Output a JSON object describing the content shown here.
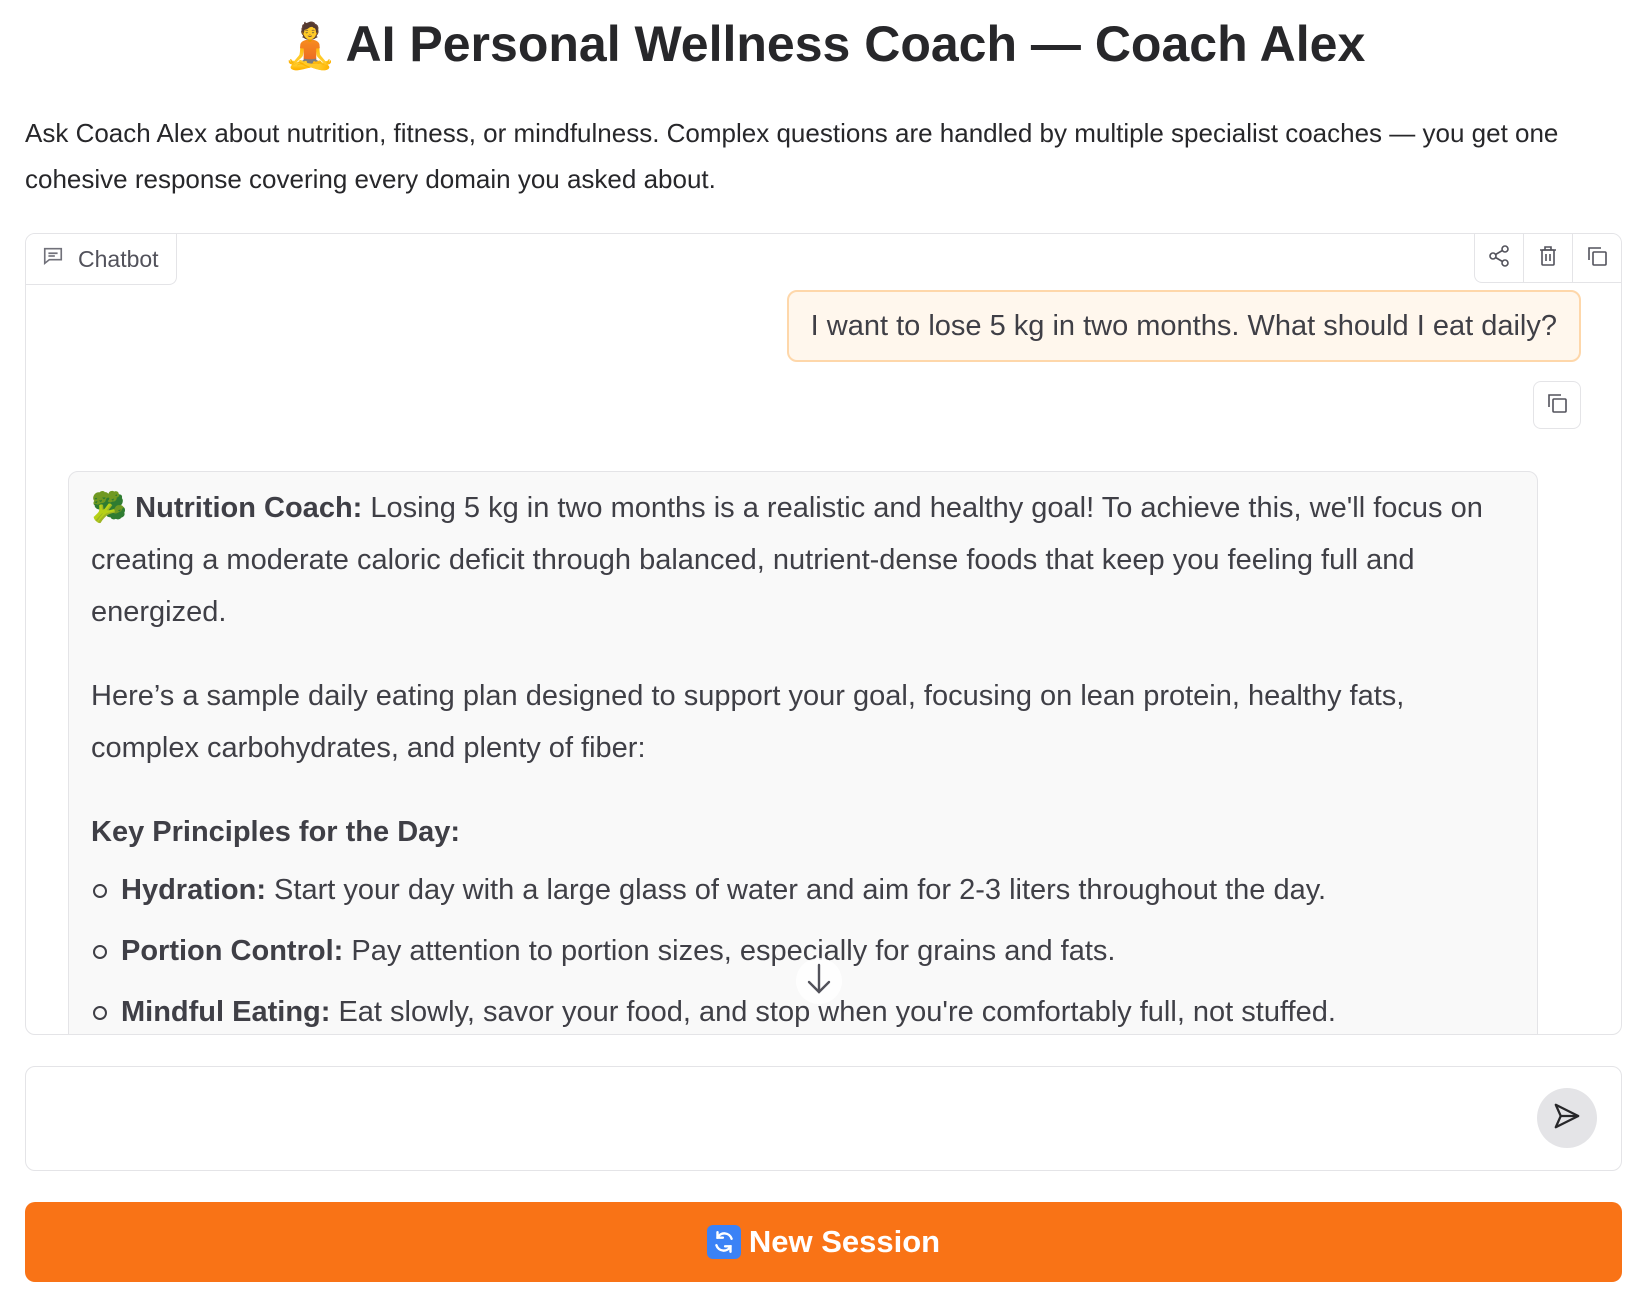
{
  "header": {
    "title_emoji": "🧘",
    "title": "AI Personal Wellness Coach — Coach Alex",
    "description": "Ask Coach Alex about nutrition, fitness, or mindfulness. Complex questions are handled by multiple specialist coaches — you get one cohesive response covering every domain you asked about."
  },
  "chatbot": {
    "label": "Chatbot",
    "icon": "chat-bubble-icon",
    "toolbar": [
      "share-icon",
      "trash-icon",
      "copy-icon"
    ]
  },
  "messages": {
    "user": {
      "text": "I want to lose 5 kg in two months. What should I eat daily?"
    },
    "bot": {
      "speaker_emoji": "🥦",
      "speaker": "Nutrition Coach:",
      "intro": " Losing 5 kg in two months is a realistic and healthy goal! To achieve this, we'll focus on creating a moderate caloric deficit through balanced, nutrient-dense foods that keep you feeling full and energized.",
      "plan_intro": "Here’s a sample daily eating plan designed to support your goal, focusing on lean protein, healthy fats, complex carbohydrates, and plenty of fiber:",
      "principles_heading": "Key Principles for the Day:",
      "principles": [
        {
          "title": "Hydration:",
          "text": " Start your day with a large glass of water and aim for 2-3 liters throughout the day."
        },
        {
          "title": "Portion Control:",
          "text": " Pay attention to portion sizes, especially for grains and fats."
        },
        {
          "title": "Mindful Eating:",
          "text": " Eat slowly, savor your food, and stop when you're comfortably full, not stuffed."
        }
      ]
    }
  },
  "input": {
    "placeholder": "",
    "value": ""
  },
  "new_session": {
    "emoji": "🔄",
    "label": "New Session"
  },
  "colors": {
    "accent": "#f97316",
    "user_bubble_bg": "#fff7ed",
    "user_bubble_border": "#fed7aa",
    "bot_bubble_bg": "#f9f9f9"
  }
}
